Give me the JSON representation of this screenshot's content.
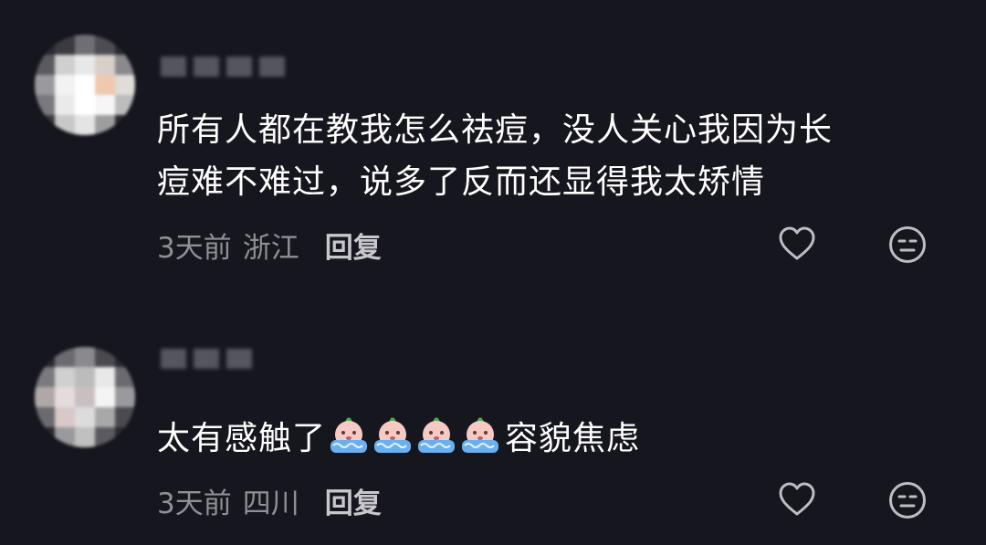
{
  "comments": [
    {
      "text_line1": "所有人都在教我怎么祛痘，没人关心我因为长",
      "text_line2": "痘难不难过，说多了反而还显得我太矫情",
      "time": "3天前",
      "location": "浙江",
      "reply_label": "回复",
      "like_icon": "heart-outline-icon",
      "dislike_icon": "meh-face-icon"
    },
    {
      "text_before": "太有感触了",
      "emoji_icon": "crying-emoji-icon",
      "emoji_count": 4,
      "text_after": "容貌焦虑",
      "time": "3天前",
      "location": "四川",
      "reply_label": "回复",
      "like_icon": "heart-outline-icon",
      "dislike_icon": "meh-face-icon"
    }
  ],
  "colors": {
    "background": "#16161e",
    "text": "#ffffff",
    "meta": "#8f8f96",
    "icon": "#bdbdc4"
  }
}
